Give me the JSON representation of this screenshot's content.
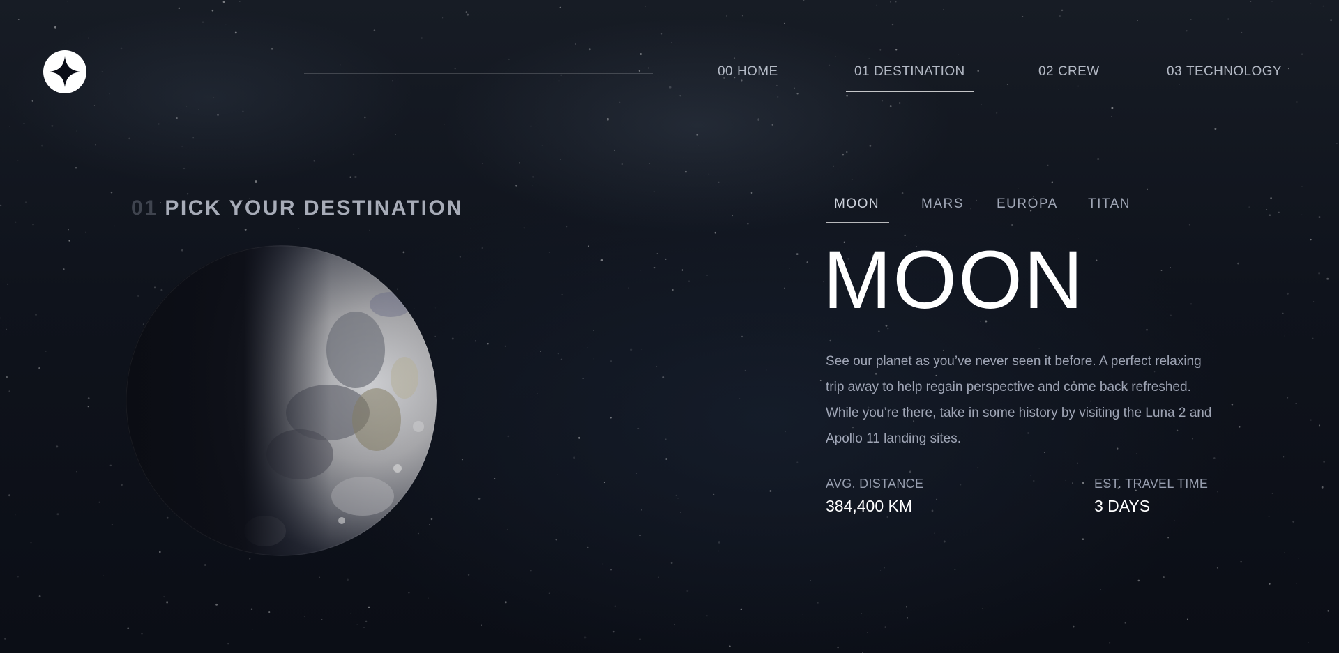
{
  "header": {
    "nav": [
      {
        "number": "00",
        "label": "HOME",
        "active": false
      },
      {
        "number": "01",
        "label": "DESTINATION",
        "active": true
      },
      {
        "number": "02",
        "label": "CREW",
        "active": false
      },
      {
        "number": "03",
        "label": "TECHNOLOGY",
        "active": false
      }
    ]
  },
  "main": {
    "section": {
      "number": "01",
      "title": "PICK YOUR DESTINATION"
    },
    "tabs": [
      {
        "label": "MOON",
        "active": true
      },
      {
        "label": "MARS",
        "active": false
      },
      {
        "label": "EUROPA",
        "active": false
      },
      {
        "label": "TITAN",
        "active": false
      }
    ],
    "destination": {
      "name": "MOON",
      "description": "See our planet as you’ve never seen it before. A perfect relaxing trip away to help regain perspective and come back refreshed. While you’re there, take in some history by visiting the Luna 2 and Apollo 11 landing sites.",
      "stats": [
        {
          "label": "AVG. DISTANCE",
          "value": "384,400 KM"
        },
        {
          "label": "EST. TRAVEL TIME",
          "value": "3 DAYS"
        }
      ]
    }
  },
  "icons": {
    "logo": "four-point-star-logo-icon",
    "planet_image": "moon-image"
  },
  "colors": {
    "background": "#0d1018",
    "text_primary": "#ffffff",
    "text_muted": "#c7cdd9"
  }
}
